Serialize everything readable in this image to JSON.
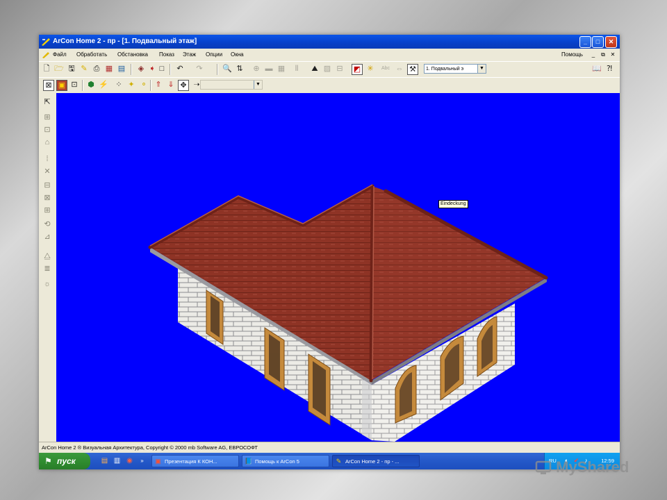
{
  "window": {
    "title": "ArCon  Home 2 - пр - [1. Подвальный этаж]",
    "buttons": {
      "minimize": "_",
      "maximize": "□",
      "close": "✕"
    }
  },
  "menu": {
    "items": [
      "Файл",
      "Обработать",
      "Обстановка",
      "Показ",
      "Этаж",
      "Опции",
      "Окна"
    ],
    "help": "Помощь",
    "mdi": [
      "_",
      "⧉",
      "✕"
    ]
  },
  "toolbar": {
    "floor_selector": "1. Подвальный э"
  },
  "viewport": {
    "background_color": "#0000fe",
    "tooltip": "Eindeckung"
  },
  "status": {
    "text": "ArCon Home 2 ® Визуальная Архитектура, Copyright © 2000 mb Software AG, ЕВРОСОФТ"
  },
  "taskbar": {
    "start_label": "пуск",
    "tasks": [
      "Презентация К КОН...",
      "Помощь к ArCon 5",
      "ArCon  Home 2 - пр - ..."
    ],
    "overflow": "»",
    "tray": {
      "lang": "RU",
      "time": "12:59"
    }
  },
  "watermark": {
    "text": "MyShared"
  }
}
